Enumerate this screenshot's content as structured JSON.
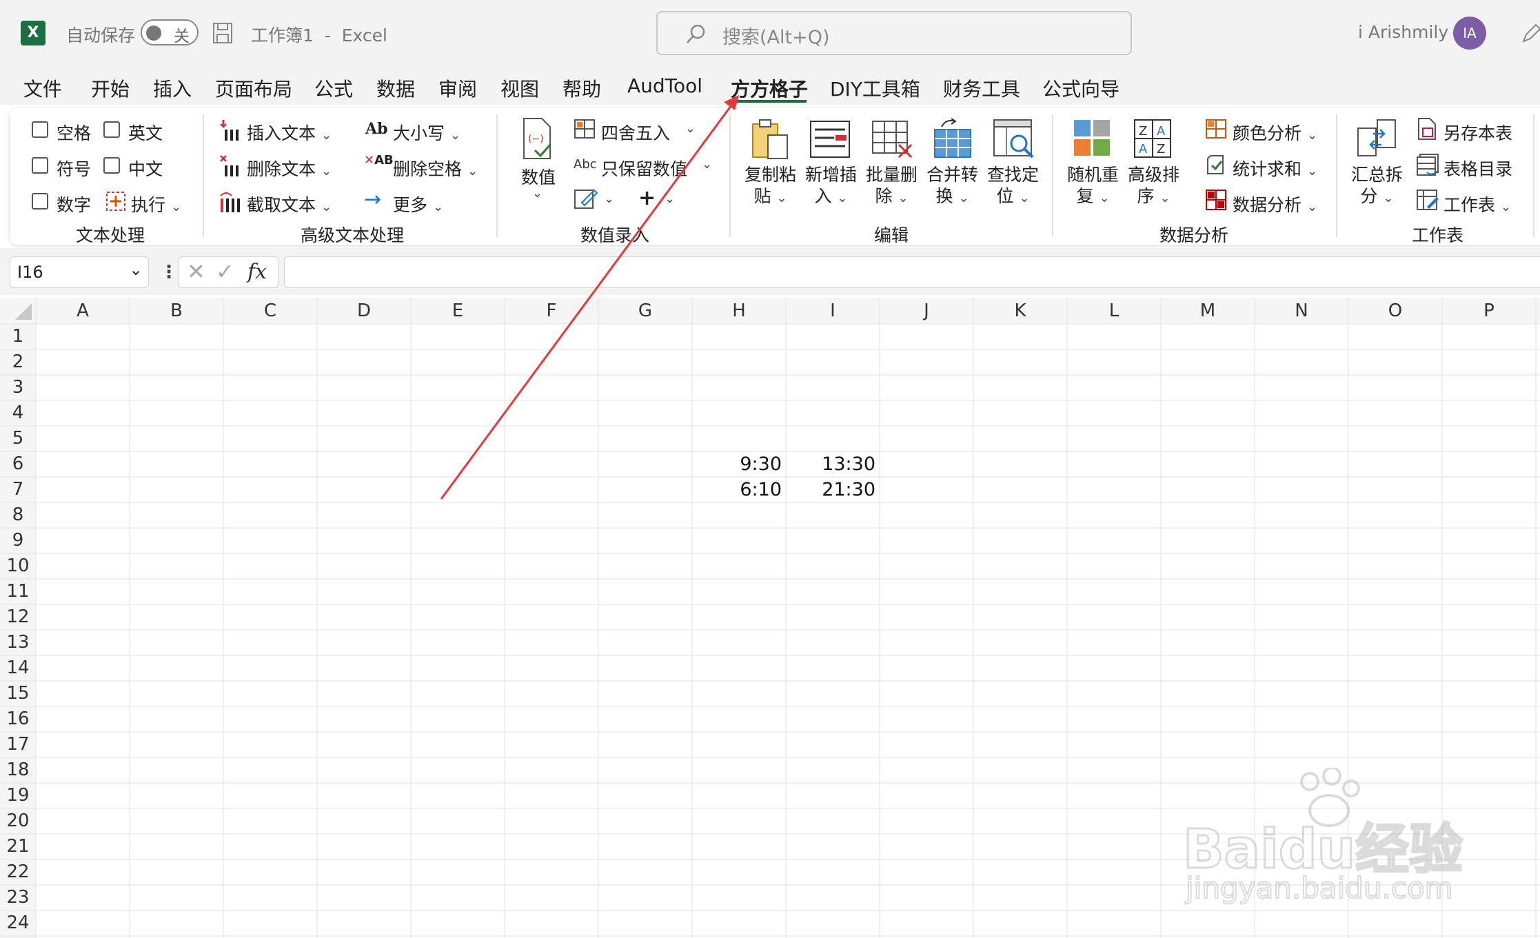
{
  "titlebar": {
    "autosave_label": "自动保存",
    "autosave_state": "关",
    "document_title": "工作簿1  -  Excel",
    "search_placeholder": "搜索(Alt+Q)",
    "user_name": "i Arishmily",
    "user_initials": "IA",
    "avatar_color": "#7b5ea7",
    "excel_green": "#1d6f42"
  },
  "tabs": [
    "文件",
    "开始",
    "插入",
    "页面布局",
    "公式",
    "数据",
    "审阅",
    "视图",
    "帮助",
    "AudTool",
    "方方格子",
    "DIY工具箱",
    "财务工具",
    "公式向导"
  ],
  "active_tab": "方方格子",
  "ribbon": {
    "text_processing": {
      "checkboxes": [
        "空格",
        "英文",
        "符号",
        "中文",
        "数字"
      ],
      "execute": "执行",
      "group": "文本处理"
    },
    "advanced_text": {
      "insert_text": "插入文本",
      "delete_text": "删除文本",
      "extract_text": "截取文本",
      "case": "大小写",
      "delete_space": "删除空格",
      "more": "更多",
      "group": "高级文本处理"
    },
    "value_entry": {
      "value_button": "数值",
      "round": "四舍五入",
      "keep_value": "只保留数值",
      "group": "数值录入"
    },
    "edit": {
      "copy_paste": [
        "复制粘",
        "贴"
      ],
      "new_insert": [
        "新增插",
        "入"
      ],
      "batch_delete": [
        "批量删",
        "除"
      ],
      "merge_convert": [
        "合并转",
        "换"
      ],
      "find_locate": [
        "查找定",
        "位"
      ],
      "group": "编辑"
    },
    "data_analysis": {
      "random_repeat": [
        "随机重",
        "复"
      ],
      "advanced_sort": [
        "高级排",
        "序"
      ],
      "color_analysis": "颜色分析",
      "stat_sum": "统计求和",
      "data_analysis": "数据分析",
      "group": "数据分析"
    },
    "worksheet": {
      "summary_split": [
        "汇总拆",
        "分"
      ],
      "save_sheet": "另存本表",
      "sheet_index": "表格目录",
      "sheet": "工作表",
      "group": "工作表"
    }
  },
  "formula_bar": {
    "name_box": "I16",
    "fx": "fx"
  },
  "columns": [
    "A",
    "B",
    "C",
    "D",
    "E",
    "F",
    "G",
    "H",
    "I",
    "J",
    "K",
    "L",
    "M",
    "N",
    "O",
    "P"
  ],
  "rows": [
    "1",
    "2",
    "3",
    "4",
    "5",
    "6",
    "7",
    "8",
    "9",
    "10",
    "11",
    "12",
    "13",
    "14",
    "15",
    "16",
    "17",
    "18",
    "19",
    "20",
    "21",
    "22",
    "23",
    "24"
  ],
  "cells": {
    "H6": "9:30",
    "I6": "13:30",
    "H7": "6:10",
    "I7": "21:30"
  },
  "annotation_color": "#e8383a",
  "watermark": {
    "brand": "Baidu经验",
    "url": "jingyan.baidu.com"
  }
}
